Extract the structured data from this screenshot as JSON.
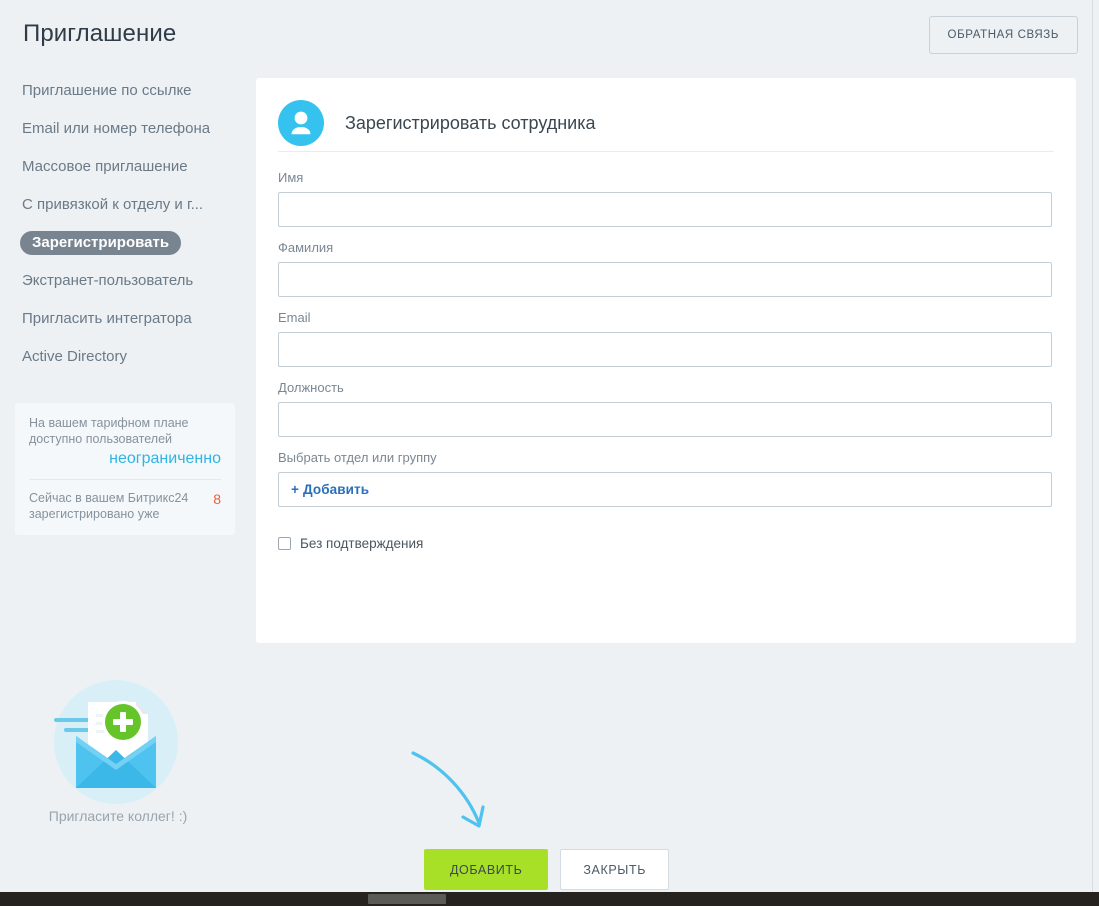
{
  "header": {
    "title": "Приглашение",
    "feedback_button": "ОБРАТНАЯ СВЯЗЬ"
  },
  "sidebar": {
    "items": [
      {
        "label": "Приглашение по ссылке",
        "active": false
      },
      {
        "label": "Email или номер телефона",
        "active": false
      },
      {
        "label": "Массовое приглашение",
        "active": false
      },
      {
        "label": "С привязкой к отделу и г...",
        "active": false
      },
      {
        "label": "Зарегистрировать",
        "active": true
      },
      {
        "label": "Экстранет-пользователь",
        "active": false
      },
      {
        "label": "Пригласить интегратора",
        "active": false
      },
      {
        "label": "Active Directory",
        "active": false
      }
    ],
    "info_box": {
      "plan_text": "На вашем тарифном плане доступно пользователей",
      "plan_value": "неограниченно",
      "registered_text": "Сейчас в вашем Битрикс24 зарегистрировано уже",
      "registered_count": "8"
    },
    "illustration_caption": "Пригласите коллег! :)"
  },
  "card": {
    "title": "Зарегистрировать сотрудника",
    "avatar_icon": "user-avatar-icon",
    "fields": [
      {
        "label": "Имя",
        "value": "",
        "placeholder": "",
        "name": "first-name"
      },
      {
        "label": "Фамилия",
        "value": "",
        "placeholder": "",
        "name": "last-name"
      },
      {
        "label": "Email",
        "value": "",
        "placeholder": "",
        "name": "email"
      },
      {
        "label": "Должность",
        "value": "",
        "placeholder": "",
        "name": "position"
      }
    ],
    "department": {
      "label": "Выбрать отдел или группу",
      "add_label": "Добавить",
      "add_plus": "+"
    },
    "checkbox": {
      "label": "Без подтверждения",
      "checked": false
    }
  },
  "footer": {
    "submit_label": "ДОБАВИТЬ",
    "close_label": "ЗАКРЫТЬ"
  },
  "colors": {
    "page_background": "#edf1f4",
    "accent_cyan": "#35c2ef",
    "accent_green": "#a8e028",
    "link_blue": "#2a6fbb",
    "count_orange": "#e8603c",
    "active_pill": "#798491"
  }
}
